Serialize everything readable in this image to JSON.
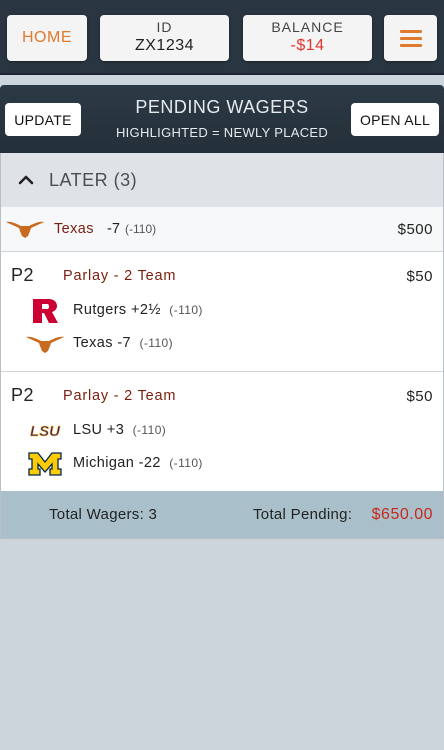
{
  "topbar": {
    "home_label": "HOME",
    "id_label": "ID",
    "id_value": "ZX1234",
    "balance_label": "BALANCE",
    "balance_value": "-$14",
    "menu_icon": "hamburger-menu-icon"
  },
  "header": {
    "update_label": "UPDATE",
    "title": "PENDING WAGERS",
    "subtitle": "HIGHLIGHTED = NEWLY PLACED",
    "open_all_label": "OPEN ALL"
  },
  "group": {
    "label": "LATER (3)",
    "icon": "chevron-up-icon"
  },
  "wagers": [
    {
      "team": "Texas",
      "line": "-7",
      "odds": "(-110)",
      "amount": "$500",
      "logo": "longhorn-logo"
    },
    {
      "tag": "P2",
      "type": "Parlay - 2 Team",
      "amount": "$50",
      "legs": [
        {
          "team": "Rutgers",
          "line": "+2½",
          "odds": "(-110)",
          "logo": "rutgers-r-logo"
        },
        {
          "team": "Texas",
          "line": "-7",
          "odds": "(-110)",
          "logo": "longhorn-logo"
        }
      ]
    },
    {
      "tag": "P2",
      "type": "Parlay - 2 Team",
      "amount": "$50",
      "legs": [
        {
          "team": "LSU",
          "line": "+3",
          "odds": "(-110)",
          "logo": "lsu-logo"
        },
        {
          "team": "Michigan",
          "line": "-22",
          "odds": "(-110)",
          "logo": "michigan-m-logo"
        }
      ]
    }
  ],
  "footer": {
    "total_wagers_label": "Total Wagers: 3",
    "total_pending_label": "Total Pending:",
    "total_pending_value": "$650.00"
  },
  "colors": {
    "accent": "#e07a2c",
    "topbar_bg": "#293540",
    "negative": "#e0342c",
    "team_red": "#7a1f10",
    "footer_bg": "#a9c0ca"
  }
}
